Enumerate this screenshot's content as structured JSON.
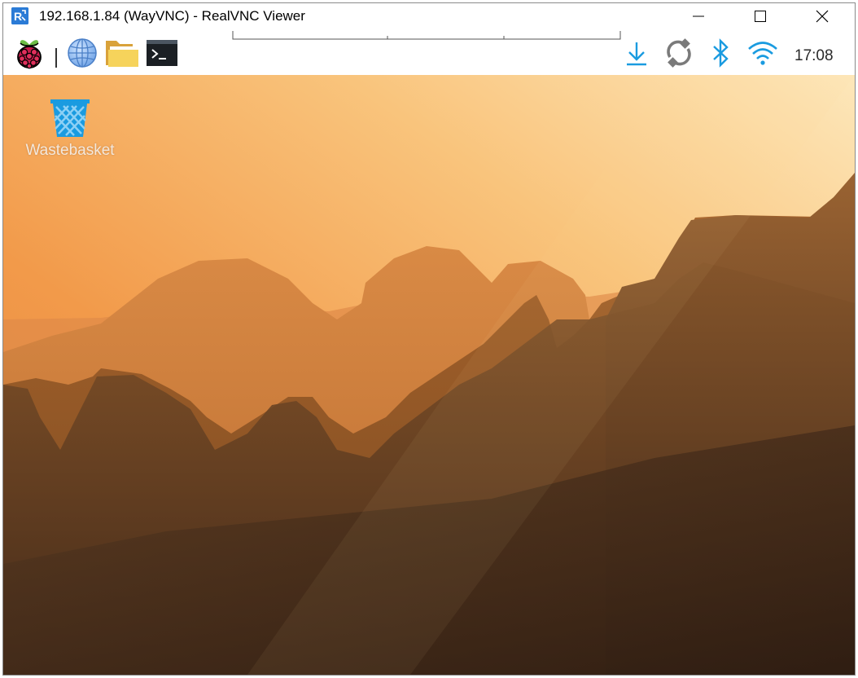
{
  "window": {
    "title": "192.168.1.84 (WayVNC) - RealVNC Viewer",
    "app_icon": "realvnc-logo-icon",
    "controls": {
      "minimize": "minimize-icon",
      "maximize": "maximize-icon",
      "close": "close-icon"
    }
  },
  "panel": {
    "launchers": [
      {
        "name": "raspberry-menu",
        "icon": "raspberry-pi-icon"
      },
      {
        "name": "web-browser",
        "icon": "globe-icon"
      },
      {
        "name": "file-manager",
        "icon": "folder-icon"
      },
      {
        "name": "terminal",
        "icon": "terminal-icon"
      }
    ],
    "tray": [
      {
        "name": "updates",
        "icon": "download-icon"
      },
      {
        "name": "vnc",
        "icon": "vnc-connection-icon"
      },
      {
        "name": "bluetooth",
        "icon": "bluetooth-icon"
      },
      {
        "name": "wifi",
        "icon": "wifi-icon"
      }
    ],
    "clock": "17:08"
  },
  "desktop": {
    "icons": [
      {
        "label": "Wastebasket",
        "icon": "wastebasket-icon"
      }
    ]
  },
  "colors": {
    "accent_blue": "#1a9be0",
    "sky_light": "#fde6b8",
    "sky_orange": "#f29a4a"
  }
}
